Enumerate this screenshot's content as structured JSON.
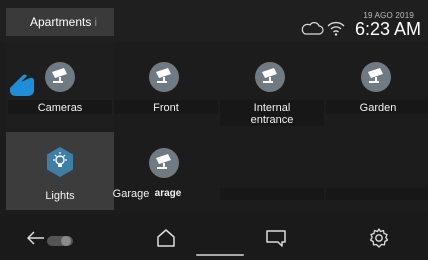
{
  "header": {
    "tab_label": "Apartments",
    "tab_cursor": "i",
    "date": "19 AGO 2019",
    "time": "6:23 AM"
  },
  "tiles": [
    {
      "label": "Cameras",
      "icon": "camera-icon"
    },
    {
      "label": "Front",
      "icon": "camera-icon"
    },
    {
      "label": "Internal entrance",
      "line1": "Internal",
      "line2": "entrance",
      "icon": "camera-icon"
    },
    {
      "label": "Garden",
      "icon": "camera-icon"
    },
    {
      "label": "Lights",
      "icon": "light-bulb-icon"
    },
    {
      "label": "Garage",
      "ghost": "arage",
      "icon": "camera-icon"
    }
  ],
  "navbar": {
    "items": [
      "back-arrow-icon",
      "home-icon",
      "chat-icon",
      "settings-gear-icon"
    ]
  },
  "colors": {
    "background": "#1c1c1c",
    "icon_circle": "#6f7a82",
    "light_icon": "#3f7fa6",
    "pointer_hand": "#1e8fd6"
  }
}
